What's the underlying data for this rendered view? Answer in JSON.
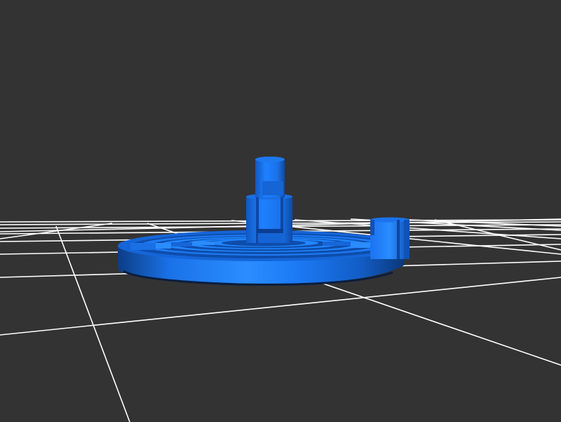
{
  "viewer": {
    "background_color": "#333333",
    "grid_color": "#ffffff",
    "model_color": "#1a7fff",
    "model_shade_dark": "#0a3f8a",
    "model_shade_mid": "#145fd0",
    "model_highlight": "#3a9bff"
  },
  "model": {
    "name": "",
    "parts": [
      "base-disc",
      "spiral-grooves",
      "center-shaft",
      "shaft-collar",
      "side-post"
    ]
  }
}
